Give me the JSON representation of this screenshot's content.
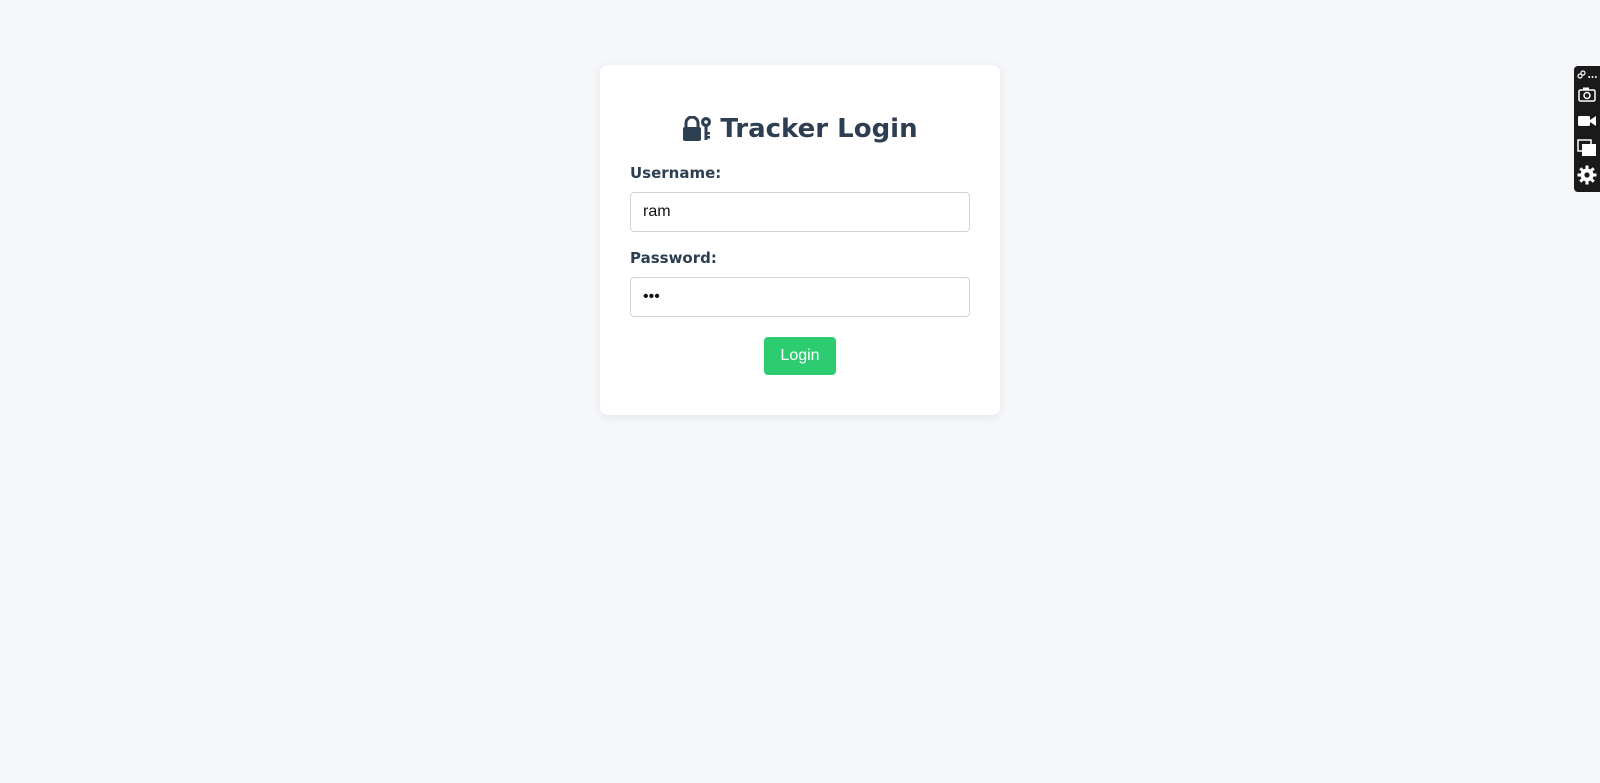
{
  "login": {
    "title": "Tracker Login",
    "username_label": "Username:",
    "username_value": "ram",
    "password_label": "Password:",
    "password_value": "abc",
    "submit_label": "Login"
  },
  "colors": {
    "page_background": "#f5f7fa",
    "title_text": "#2c3e50",
    "button_background": "#2ecc71",
    "toolbar_background": "#1a1a1a"
  },
  "icons": {
    "title": "lock-key-icon",
    "toolbar": [
      "link-icon",
      "more-icon",
      "camera-icon",
      "video-camera-icon",
      "window-icon",
      "gear-icon"
    ]
  }
}
